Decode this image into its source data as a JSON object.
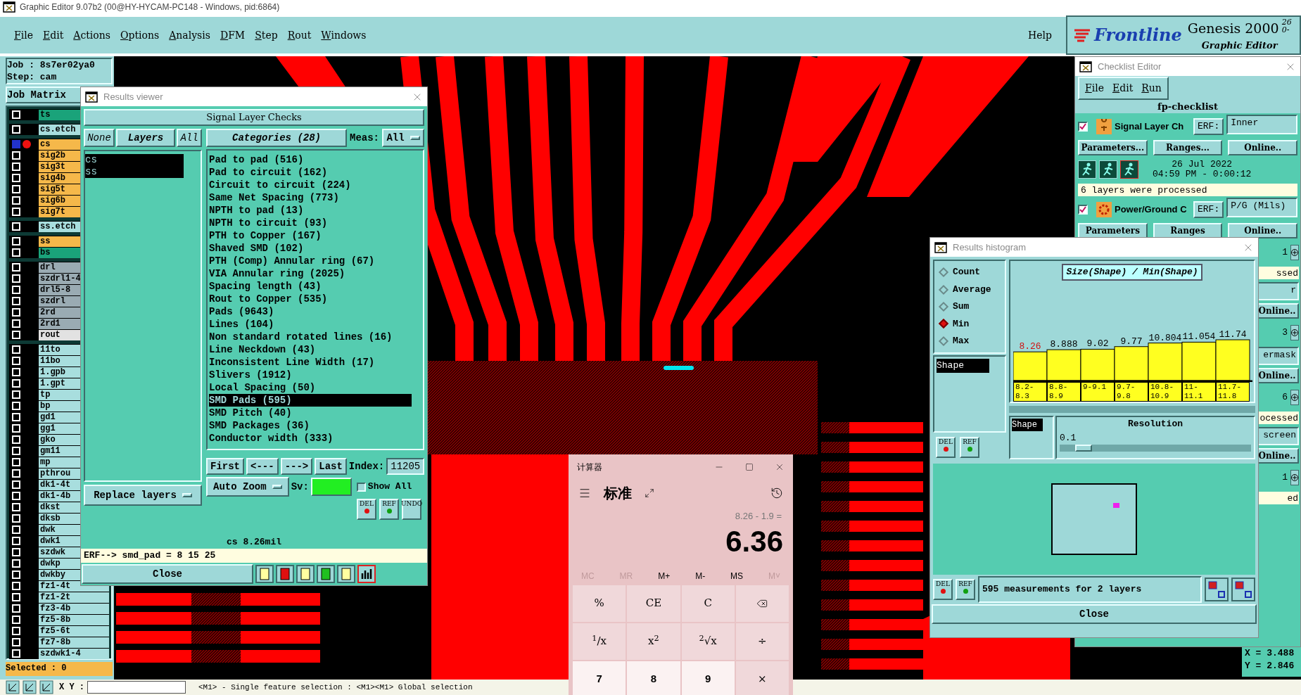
{
  "window": {
    "title": "Graphic Editor 9.07b2 (00@HY-HYCAM-PC148 - Windows, pid:6864)"
  },
  "menu": [
    "File",
    "Edit",
    "Actions",
    "Options",
    "Analysis",
    "DFM",
    "Step",
    "Rout",
    "Windows"
  ],
  "help": "Help",
  "logo": {
    "brand": "Frontline",
    "product": "Genesis 2000",
    "version": "26",
    "version_2": "0-",
    "subtitle": "Graphic Editor"
  },
  "job_panel": {
    "job": "Job : 8s7er02ya0",
    "step": "Step: cam",
    "matrix_button": "Job Matrix",
    "selected_count": "Selected : 0",
    "layer_groups": [
      [
        {
          "name": "ts",
          "color": "#1aa37a",
          "selected": false
        }
      ],
      [
        {
          "name": "cs.etch",
          "color": "#a8dede",
          "selected": false
        }
      ],
      [
        {
          "name": "cs",
          "color": "#f5b84a",
          "selected": true
        },
        {
          "name": "sig2b",
          "color": "#f5b84a",
          "selected": false
        },
        {
          "name": "sig3t",
          "color": "#f5b84a",
          "selected": false
        },
        {
          "name": "sig4b",
          "color": "#f5b84a",
          "selected": false
        },
        {
          "name": "sig5t",
          "color": "#f5b84a",
          "selected": false
        },
        {
          "name": "sig6b",
          "color": "#f5b84a",
          "selected": false
        },
        {
          "name": "sig7t",
          "color": "#f5b84a",
          "selected": false
        }
      ],
      [
        {
          "name": "ss.etch",
          "color": "#a8dede",
          "selected": false
        }
      ],
      [
        {
          "name": "ss",
          "color": "#f5b84a",
          "selected": false
        },
        {
          "name": "bs",
          "color": "#1aa37a",
          "selected": false
        }
      ],
      [
        {
          "name": "drl",
          "color": "#9aabb3",
          "selected": false
        },
        {
          "name": "szdrl1-4",
          "color": "#9aabb3",
          "selected": false
        },
        {
          "name": "drl5-8",
          "color": "#9aabb3",
          "selected": false
        },
        {
          "name": "szdrl",
          "color": "#9aabb3",
          "selected": false
        },
        {
          "name": "2rd",
          "color": "#9aabb3",
          "selected": false
        },
        {
          "name": "2rd1",
          "color": "#9aabb3",
          "selected": false
        },
        {
          "name": "rout",
          "color": "#e2e2e2",
          "selected": false
        }
      ],
      [
        {
          "name": "11to",
          "color": "#a8dede",
          "selected": false
        },
        {
          "name": "11bo",
          "color": "#a8dede",
          "selected": false
        },
        {
          "name": "1.gpb",
          "color": "#a8dede",
          "selected": false
        },
        {
          "name": "1.gpt",
          "color": "#a8dede",
          "selected": false
        },
        {
          "name": "tp",
          "color": "#a8dede",
          "selected": false
        },
        {
          "name": "bp",
          "color": "#a8dede",
          "selected": false
        },
        {
          "name": "gd1",
          "color": "#a8dede",
          "selected": false
        },
        {
          "name": "gg1",
          "color": "#a8dede",
          "selected": false
        },
        {
          "name": "gko",
          "color": "#a8dede",
          "selected": false
        },
        {
          "name": "gm11",
          "color": "#a8dede",
          "selected": false
        },
        {
          "name": "mp",
          "color": "#a8dede",
          "selected": false
        },
        {
          "name": "pthrou",
          "color": "#a8dede",
          "selected": false
        },
        {
          "name": "dk1-4t",
          "color": "#a8dede",
          "selected": false
        },
        {
          "name": "dk1-4b",
          "color": "#a8dede",
          "selected": false
        },
        {
          "name": "dkst",
          "color": "#a8dede",
          "selected": false
        },
        {
          "name": "dksb",
          "color": "#a8dede",
          "selected": false
        },
        {
          "name": "dwk",
          "color": "#a8dede",
          "selected": false
        },
        {
          "name": "dwk1",
          "color": "#a8dede",
          "selected": false
        },
        {
          "name": "szdwk",
          "color": "#a8dede",
          "selected": false
        },
        {
          "name": "dwkp",
          "color": "#a8dede",
          "selected": false
        },
        {
          "name": "dwkby",
          "color": "#a8dede",
          "selected": false
        },
        {
          "name": "fz1-4t",
          "color": "#a8dede",
          "selected": false
        },
        {
          "name": "fz1-2t",
          "color": "#a8dede",
          "selected": false
        },
        {
          "name": "fz3-4b",
          "color": "#a8dede",
          "selected": false
        },
        {
          "name": "fz5-8b",
          "color": "#a8dede",
          "selected": false
        },
        {
          "name": "fz5-6t",
          "color": "#a8dede",
          "selected": false
        },
        {
          "name": "fz7-8b",
          "color": "#a8dede",
          "selected": false
        },
        {
          "name": "szdwk1-4",
          "color": "#a8dede",
          "selected": false
        }
      ]
    ]
  },
  "status_bar": {
    "xy_label": "X Y :",
    "hint": "<M1> - Single feature selection : <M1><M1> Global selection"
  },
  "coordinates": [
    "X = 3.488",
    "Y = 2.846"
  ],
  "results_viewer": {
    "title": "Results viewer",
    "heading": "Signal Layer Checks",
    "none_button": "None",
    "layers_button": "Layers",
    "all_button": "All",
    "layers": [
      {
        "name": "cs",
        "selected": true
      },
      {
        "name": "ss",
        "selected": true
      }
    ],
    "categories_button": "Categories (28)",
    "meas_label": "Meas:",
    "meas_value": "All",
    "categories": [
      {
        "label": "Pad to pad (516)",
        "selected": false
      },
      {
        "label": "Pad to circuit (162)",
        "selected": false
      },
      {
        "label": "Circuit to circuit (224)",
        "selected": false
      },
      {
        "label": "Same Net Spacing (773)",
        "selected": false
      },
      {
        "label": "NPTH to pad (13)",
        "selected": false
      },
      {
        "label": "NPTH to circuit (93)",
        "selected": false
      },
      {
        "label": "PTH to Copper (167)",
        "selected": false
      },
      {
        "label": "Shaved SMD (102)",
        "selected": false
      },
      {
        "label": "PTH (Comp) Annular ring (67)",
        "selected": false
      },
      {
        "label": "VIA Annular ring (2025)",
        "selected": false
      },
      {
        "label": "Spacing length (43)",
        "selected": false
      },
      {
        "label": "Rout to Copper (535)",
        "selected": false
      },
      {
        "label": "Pads (9643)",
        "selected": false
      },
      {
        "label": "Lines (104)",
        "selected": false
      },
      {
        "label": "Non standard rotated lines (16)",
        "selected": false
      },
      {
        "label": "Line Neckdown (43)",
        "selected": false
      },
      {
        "label": "Inconsistent Line Width (17)",
        "selected": false
      },
      {
        "label": "Slivers (1912)",
        "selected": false
      },
      {
        "label": "Local Spacing (50)",
        "selected": false
      },
      {
        "label": "SMD Pads (595)",
        "selected": true
      },
      {
        "label": "SMD Pitch (40)",
        "selected": false
      },
      {
        "label": "SMD Packages (36)",
        "selected": false
      },
      {
        "label": "Conductor width (333)",
        "selected": false
      }
    ],
    "nav": [
      "First",
      "<---",
      "--->",
      "Last"
    ],
    "index_label": "Index:",
    "index_value": "11205",
    "zoom_button": "Auto Zoom",
    "sv_label": "Sv:",
    "show_all": {
      "label": "Show All",
      "checked": false
    },
    "replace_button": "Replace layers",
    "tools": [
      "DEL",
      "REF",
      "UNDO"
    ],
    "measurement": "cs 8.26mil",
    "erf_line": "ERF--> smd_pad = 8 15 25",
    "close": "Close"
  },
  "checklist_editor": {
    "title": "Checklist Editor",
    "menu": [
      "File",
      "Edit",
      "Run"
    ],
    "name": "fp-checklist",
    "checks": [
      {
        "kind": "signal",
        "name": "Signal Layer Ch",
        "checked": true,
        "erf_label": "ERF:",
        "erf": "Inner",
        "buttons": [
          "Parameters...",
          "Ranges...",
          "Online.."
        ],
        "date": "26 Jul 2022",
        "time": "04:59 PM - 0:00:12",
        "note": "6 layers were processed"
      },
      {
        "kind": "power",
        "name": "Power/Ground C",
        "checked": true,
        "erf_label": "ERF:",
        "erf": "P/G (Mils)",
        "buttons": [
          "Parameters",
          "Ranges",
          "Online.."
        ]
      }
    ],
    "covered_rows": [
      {
        "kind": "time",
        "text": "1"
      },
      {
        "kind": "note",
        "text": "ssed"
      },
      {
        "kind": "field",
        "text": "r"
      },
      {
        "kind": "button",
        "text": "Online.."
      },
      {
        "kind": "time",
        "text": "3"
      },
      {
        "kind": "field",
        "text": "ermask"
      },
      {
        "kind": "button",
        "text": "Online.."
      },
      {
        "kind": "time",
        "text": "6"
      },
      {
        "kind": "note",
        "text": "ocessed"
      },
      {
        "kind": "field",
        "text": "screen"
      },
      {
        "kind": "button",
        "text": "Online.."
      },
      {
        "kind": "time",
        "text": "1"
      },
      {
        "kind": "note",
        "text": "ed"
      }
    ]
  },
  "histogram": {
    "title": "Results histogram",
    "options": [
      {
        "label": "Count",
        "selected": false
      },
      {
        "label": "Average",
        "selected": false
      },
      {
        "label": "Sum",
        "selected": false
      },
      {
        "label": "Min",
        "selected": true
      },
      {
        "label": "Max",
        "selected": false
      }
    ],
    "fields": [
      {
        "label": "Shape",
        "selected": true
      }
    ],
    "chart_data": {
      "type": "bar",
      "title": "Size(Shape) / Min(Shape)",
      "categories": [
        "8.2-8.3",
        "8.8-8.9",
        "9-9.1",
        "9.7-9.8",
        "10.8-10.9",
        "11-11.1",
        "11.7-11.8"
      ],
      "values": [
        8.26,
        8.888,
        9.02,
        9.77,
        10.804,
        11.054,
        11.74
      ],
      "value_labels": [
        "8.26",
        "8.888",
        "9.02",
        "9.77",
        "10.804",
        "11.054",
        "11.74"
      ]
    },
    "group_fields": [
      {
        "label": "Shape",
        "selected": true
      }
    ],
    "resolution_label": "Resolution",
    "resolution_value": "0.1",
    "resolution": {
      "level": 0.08
    },
    "tools": [
      "DEL",
      "REF"
    ],
    "footer_tools": [
      "DEL",
      "REF"
    ],
    "summary": "595 measurements for 2 layers",
    "close": "Close"
  },
  "calculator": {
    "title": "计算器",
    "mode": "标准",
    "expression": "8.26 - 1.9 =",
    "result": "6.36",
    "memory": [
      {
        "label": "MC",
        "disabled": true
      },
      {
        "label": "MR",
        "disabled": true
      },
      {
        "label": "M+",
        "disabled": false
      },
      {
        "label": "M-",
        "disabled": false
      },
      {
        "label": "MS",
        "disabled": false
      },
      {
        "label": "M˅",
        "disabled": true
      }
    ],
    "keys": [
      {
        "kind": "op",
        "label": "%"
      },
      {
        "kind": "op",
        "label": "CE"
      },
      {
        "kind": "op",
        "label": "C"
      },
      {
        "kind": "backspace"
      },
      {
        "kind": "op",
        "label": "$^{1}$/x"
      },
      {
        "kind": "op",
        "label": "x$^{2}$"
      },
      {
        "kind": "op",
        "label": "$^{2}$√x"
      },
      {
        "kind": "op",
        "label": "÷"
      },
      {
        "kind": "digit",
        "label": "7"
      },
      {
        "kind": "digit",
        "label": "8"
      },
      {
        "kind": "digit",
        "label": "9"
      },
      {
        "kind": "op",
        "label": "×"
      }
    ]
  }
}
